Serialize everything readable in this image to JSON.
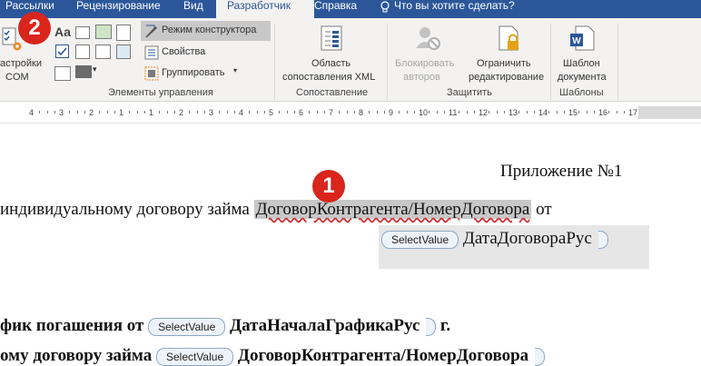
{
  "tabs": [
    {
      "label": "Рассылки",
      "active": false
    },
    {
      "label": "Рецензирование",
      "active": false
    },
    {
      "label": "Вид",
      "active": false
    },
    {
      "label": "Разработчик",
      "active": true
    },
    {
      "label": "Справка",
      "active": false
    }
  ],
  "tell_me": {
    "label": "Что вы хотите сделать?",
    "icon": "lightbulb-icon"
  },
  "ribbon": {
    "com": {
      "line1": "астройки",
      "line2": "COM",
      "icon": "gear-icon"
    },
    "controls": {
      "design_mode": "Режим конструктора",
      "properties": "Свойства",
      "group": "Группировать",
      "group_label": "Элементы управления"
    },
    "xml": {
      "line1": "Область",
      "line2": "сопоставления XML",
      "group_label": "Сопоставление"
    },
    "protect": {
      "block_line1": "Блокировать",
      "block_line2": "авторов",
      "restrict_line1": "Ограничить",
      "restrict_line2": "редактирование",
      "group_label": "Защитить"
    },
    "templates": {
      "line1": "Шаблон",
      "line2": "документа",
      "group_label": "Шаблоны"
    }
  },
  "ruler": {
    "numbers": [
      "4",
      "3",
      "2",
      "1",
      "1",
      "2",
      "3",
      "4",
      "5",
      "6",
      "7",
      "8",
      "9",
      "10",
      "11",
      "12",
      "13",
      "14",
      "15",
      "16",
      "17"
    ]
  },
  "document": {
    "appendix": "Приложение №1",
    "line2_prefix": "индивидуальному договору займа",
    "line2_field": "ДоговорКонтрагента/НомерДоговора",
    "line2_suffix": "от",
    "cc_tag": "SelectValue",
    "date_field": "ДатаДоговораРус",
    "line4_prefix": "фик погашения от",
    "line4_field": "ДатаНачалаГрафикаРус",
    "line4_suffix": "г.",
    "line5_prefix": "ому договору займа",
    "line5_field": "ДоговорКонтрагента/НомерДоговора"
  },
  "badges": {
    "one": "1",
    "two": "2"
  },
  "colors": {
    "ribbon_tab_bar": "#2b579a",
    "ribbon_bg": "#f3f2f1",
    "badge": "#d9251c",
    "field_highlight": "#c8c8c8"
  }
}
